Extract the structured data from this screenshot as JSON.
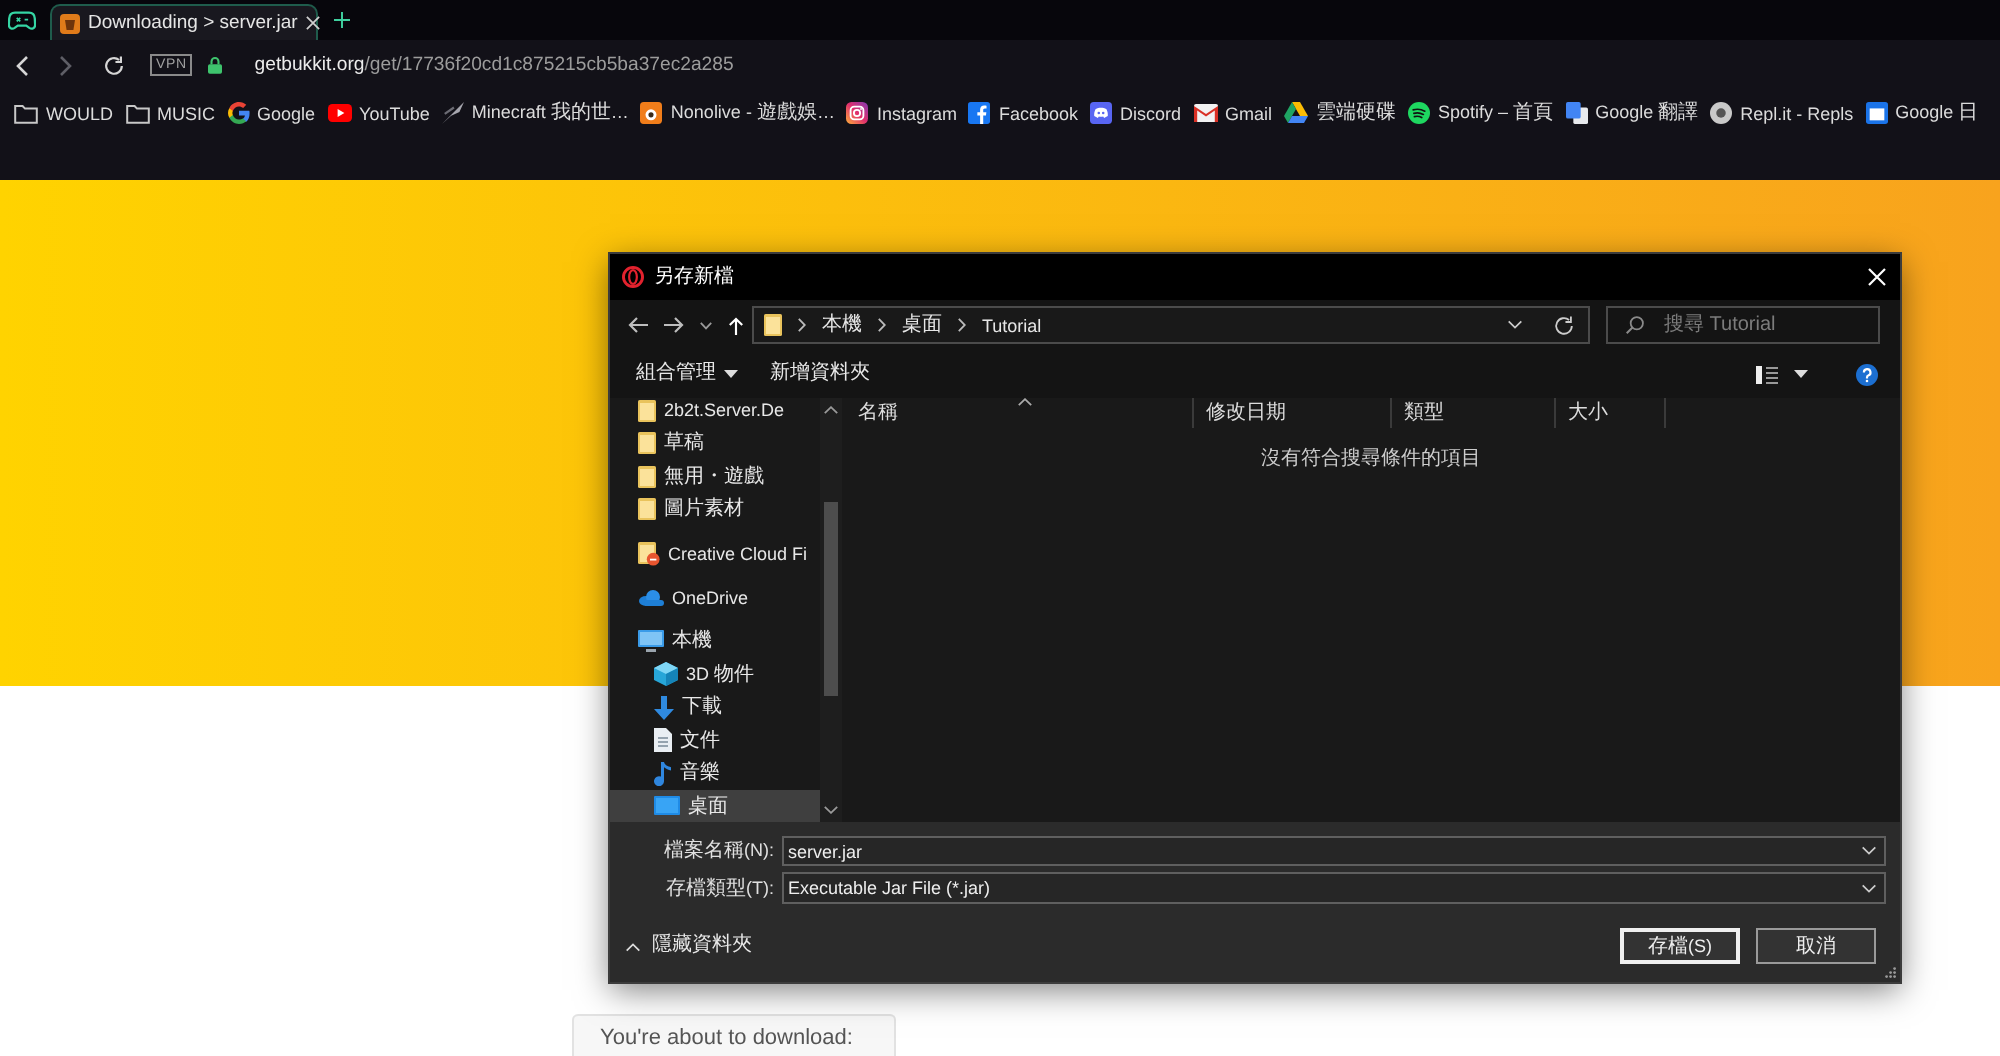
{
  "browser": {
    "tabs": [
      {
        "title": "Downloading > server.jar",
        "selected": true
      }
    ],
    "address_bar": {
      "vpn_badge": "VPN",
      "host": "getbukkit.org",
      "path": "/get/17736f20cd1c875215cb5ba37ec2a285"
    },
    "bookmarks": [
      {
        "label": "WOULD",
        "kind": "folder"
      },
      {
        "label": "MUSIC",
        "kind": "folder"
      },
      {
        "label": "Google",
        "kind": "glogo"
      },
      {
        "label": "YouTube",
        "kind": "play"
      },
      {
        "label": "Minecraft 我的世…",
        "kind": "blade"
      },
      {
        "label": "Nonolive - 遊戲娛…",
        "kind": "tile"
      },
      {
        "label": "Instagram",
        "kind": "camera"
      },
      {
        "label": "Facebook",
        "kind": "flogo"
      },
      {
        "label": "Discord",
        "kind": "face"
      },
      {
        "label": "Gmail",
        "kind": "envelope"
      },
      {
        "label": "雲端硬碟",
        "kind": "triangle"
      },
      {
        "label": "Spotify – 首頁",
        "kind": "waves"
      },
      {
        "label": "Google 翻譯",
        "kind": "tiles"
      },
      {
        "label": "Repl.it - Repls",
        "kind": "ring"
      },
      {
        "label": "Google 日",
        "kind": "calendar"
      }
    ]
  },
  "page": {
    "download_card": {
      "text": "You're about to download:"
    }
  },
  "dialog": {
    "title": "另存新檔",
    "breadcrumb": [
      "本機",
      "桌面",
      "Tutorial"
    ],
    "search": {
      "placeholder": "搜尋 Tutorial"
    },
    "toolbar": [
      {
        "label": "組合管理",
        "kind": "menu"
      },
      {
        "label": "新增資料夾",
        "kind": "button"
      }
    ],
    "nav_items": [
      {
        "label": "2b2t.Server.De",
        "kind": "folder",
        "selected": false
      },
      {
        "label": "草稿",
        "kind": "folder",
        "selected": false
      },
      {
        "label": "無用・遊戲",
        "kind": "folder",
        "selected": false
      },
      {
        "label": "圖片素材",
        "kind": "folder",
        "selected": false
      },
      {
        "label": "Creative Cloud Fi",
        "kind": "cloudfolder",
        "selected": false
      },
      {
        "label": "OneDrive",
        "kind": "cloud",
        "selected": false
      },
      {
        "label": "本機",
        "kind": "computer",
        "selected": false,
        "children": [
          {
            "label": "3D 物件",
            "kind": "cube",
            "selected": false
          },
          {
            "label": "下載",
            "kind": "download",
            "selected": false
          },
          {
            "label": "文件",
            "kind": "document",
            "selected": false
          },
          {
            "label": "音樂",
            "kind": "music",
            "selected": false
          },
          {
            "label": "桌面",
            "kind": "desktop",
            "selected": true
          }
        ]
      }
    ],
    "columns": [
      {
        "label": "名稱",
        "sorted": true
      },
      {
        "label": "修改日期",
        "sorted": false
      },
      {
        "label": "類型",
        "sorted": false
      },
      {
        "label": "大小",
        "sorted": false
      }
    ],
    "empty_message": "沒有符合搜尋條件的項目",
    "file_name": {
      "label": "檔案名稱(N):",
      "value": "server.jar"
    },
    "file_type": {
      "label": "存檔類型(T):",
      "value": "Executable Jar File (*.jar)"
    },
    "hide_folders": "隱藏資料夾",
    "buttons": [
      {
        "label": "存檔(S)",
        "default": true
      },
      {
        "label": "取消",
        "default": false
      }
    ]
  }
}
